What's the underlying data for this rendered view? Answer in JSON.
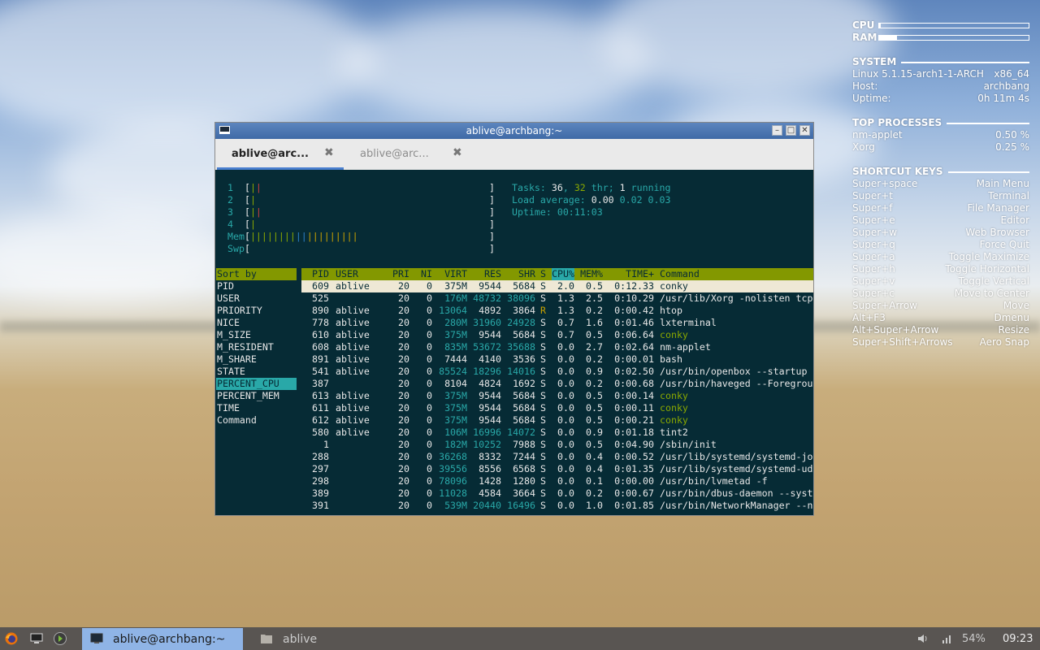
{
  "conky": {
    "cpu_label": "CPU",
    "ram_label": "RAM",
    "cpu_level": 0.01,
    "ram_level": 0.12,
    "system_title": "SYSTEM",
    "system": [
      {
        "k": "Linux 5.1.15-arch1-1-ARCH",
        "v": "x86_64"
      },
      {
        "k": "Host:",
        "v": "archbang"
      },
      {
        "k": "Uptime:",
        "v": "0h 11m 4s"
      }
    ],
    "top_title": "TOP PROCESSES",
    "top": [
      {
        "k": "nm-applet",
        "v": "0.50 %"
      },
      {
        "k": "Xorg",
        "v": "0.25 %"
      }
    ],
    "keys_title": "SHORTCUT KEYS",
    "keys": [
      {
        "k": "Super+space",
        "v": "Main Menu"
      },
      {
        "k": "Super+t",
        "v": "Terminal"
      },
      {
        "k": "Super+f",
        "v": "File Manager"
      },
      {
        "k": "Super+e",
        "v": "Editor"
      },
      {
        "k": "Super+w",
        "v": "Web Browser"
      },
      {
        "k": "Super+q",
        "v": "Force Quit"
      },
      {
        "k": "Super+a",
        "v": "Toggle Maximize"
      },
      {
        "k": "Super+h",
        "v": "Toggle Horizontal"
      },
      {
        "k": "Super+v",
        "v": "Toggle Vertical"
      },
      {
        "k": "Super+c",
        "v": "Move to Center"
      },
      {
        "k": "Super+Arrow",
        "v": "Move"
      },
      {
        "k": "Alt+F3",
        "v": "Dmenu"
      },
      {
        "k": "Alt+Super+Arrow",
        "v": "Resize"
      },
      {
        "k": "Super+Shift+Arrows",
        "v": "Aero Snap"
      }
    ]
  },
  "window": {
    "title": "ablive@archbang:~",
    "minimize": "–",
    "maximize": "□",
    "close": "✕",
    "tabs": [
      {
        "label": "ablive@arc...",
        "close": "✖"
      },
      {
        "label": "ablive@arc...",
        "close": "✖"
      }
    ]
  },
  "htop": {
    "meters": [
      {
        "label": "1",
        "bars": "||",
        "colors": [
          "green",
          "red"
        ]
      },
      {
        "label": "2",
        "bars": "|",
        "colors": [
          "green"
        ]
      },
      {
        "label": "3",
        "bars": "||",
        "colors": [
          "green",
          "red"
        ]
      },
      {
        "label": "4",
        "bars": "|",
        "colors": [
          "green"
        ]
      },
      {
        "label": "Mem",
        "bars": "|||||||||||||||||||",
        "colors": [
          "green",
          "green",
          "green",
          "green",
          "green",
          "green",
          "green",
          "green",
          "blue",
          "blue",
          "orange",
          "orange",
          "orange",
          "orange",
          "orange",
          "orange",
          "orange",
          "orange",
          "orange"
        ]
      },
      {
        "label": "Swp",
        "bars": "",
        "colors": []
      }
    ],
    "tasks_label": "Tasks: ",
    "tasks": "36",
    "thr": "32",
    "thr_label": " thr; ",
    "running": "1",
    "running_label": " running",
    "load_label": "Load average: ",
    "load1": "0.00",
    "load5": "0.02",
    "load15": "0.03",
    "uptime_label": "Uptime: ",
    "uptime": "00:11:03",
    "sort_title": "Sort by",
    "sort_items": [
      "PID",
      "USER",
      "PRIORITY",
      "NICE",
      "M_SIZE",
      "M_RESIDENT",
      "M_SHARE",
      "STATE",
      "PERCENT_CPU",
      "PERCENT_MEM",
      "TIME",
      "Command"
    ],
    "sort_selected": "PERCENT_CPU",
    "columns": [
      "PID",
      "USER",
      "PRI",
      "NI",
      "VIRT",
      "RES",
      "SHR",
      "S",
      "CPU%",
      "MEM%",
      "TIME+",
      "Command"
    ],
    "selected_column": "CPU%",
    "processes": [
      {
        "pid": "609",
        "user": "ablive",
        "pri": "20",
        "ni": "0",
        "virt": "375M",
        "res": "9544",
        "shr": "5684",
        "s": "S",
        "cpu": "2.0",
        "mem": "0.5",
        "time": "0:12.33",
        "cmd": "conky"
      },
      {
        "pid": "525",
        "user": "",
        "pri": "20",
        "ni": "0",
        "virt": "176M",
        "res": "48732",
        "shr": "38096",
        "s": "S",
        "cpu": "1.3",
        "mem": "2.5",
        "time": "0:10.29",
        "cmd": "/usr/lib/Xorg -nolisten tcp"
      },
      {
        "pid": "890",
        "user": "ablive",
        "pri": "20",
        "ni": "0",
        "virt": "13064",
        "res": "4892",
        "shr": "3864",
        "s": "R",
        "cpu": "1.3",
        "mem": "0.2",
        "time": "0:00.42",
        "cmd": "htop"
      },
      {
        "pid": "778",
        "user": "ablive",
        "pri": "20",
        "ni": "0",
        "virt": "280M",
        "res": "31960",
        "shr": "24928",
        "s": "S",
        "cpu": "0.7",
        "mem": "1.6",
        "time": "0:01.46",
        "cmd": "lxterminal"
      },
      {
        "pid": "610",
        "user": "ablive",
        "pri": "20",
        "ni": "0",
        "virt": "375M",
        "res": "9544",
        "shr": "5684",
        "s": "S",
        "cpu": "0.7",
        "mem": "0.5",
        "time": "0:06.64",
        "cmd": "conky"
      },
      {
        "pid": "608",
        "user": "ablive",
        "pri": "20",
        "ni": "0",
        "virt": "835M",
        "res": "53672",
        "shr": "35688",
        "s": "S",
        "cpu": "0.0",
        "mem": "2.7",
        "time": "0:02.64",
        "cmd": "nm-applet"
      },
      {
        "pid": "891",
        "user": "ablive",
        "pri": "20",
        "ni": "0",
        "virt": "7444",
        "res": "4140",
        "shr": "3536",
        "s": "S",
        "cpu": "0.0",
        "mem": "0.2",
        "time": "0:00.01",
        "cmd": "bash"
      },
      {
        "pid": "541",
        "user": "ablive",
        "pri": "20",
        "ni": "0",
        "virt": "85524",
        "res": "18296",
        "shr": "14016",
        "s": "S",
        "cpu": "0.0",
        "mem": "0.9",
        "time": "0:02.50",
        "cmd": "/usr/bin/openbox --startup"
      },
      {
        "pid": "387",
        "user": "",
        "pri": "20",
        "ni": "0",
        "virt": "8104",
        "res": "4824",
        "shr": "1692",
        "s": "S",
        "cpu": "0.0",
        "mem": "0.2",
        "time": "0:00.68",
        "cmd": "/usr/bin/haveged --Foregrou"
      },
      {
        "pid": "613",
        "user": "ablive",
        "pri": "20",
        "ni": "0",
        "virt": "375M",
        "res": "9544",
        "shr": "5684",
        "s": "S",
        "cpu": "0.0",
        "mem": "0.5",
        "time": "0:00.14",
        "cmd": "conky"
      },
      {
        "pid": "611",
        "user": "ablive",
        "pri": "20",
        "ni": "0",
        "virt": "375M",
        "res": "9544",
        "shr": "5684",
        "s": "S",
        "cpu": "0.0",
        "mem": "0.5",
        "time": "0:00.11",
        "cmd": "conky"
      },
      {
        "pid": "612",
        "user": "ablive",
        "pri": "20",
        "ni": "0",
        "virt": "375M",
        "res": "9544",
        "shr": "5684",
        "s": "S",
        "cpu": "0.0",
        "mem": "0.5",
        "time": "0:00.21",
        "cmd": "conky"
      },
      {
        "pid": "580",
        "user": "ablive",
        "pri": "20",
        "ni": "0",
        "virt": "106M",
        "res": "16996",
        "shr": "14072",
        "s": "S",
        "cpu": "0.0",
        "mem": "0.9",
        "time": "0:01.18",
        "cmd": "tint2"
      },
      {
        "pid": "1",
        "user": "",
        "pri": "20",
        "ni": "0",
        "virt": "182M",
        "res": "10252",
        "shr": "7988",
        "s": "S",
        "cpu": "0.0",
        "mem": "0.5",
        "time": "0:04.90",
        "cmd": "/sbin/init"
      },
      {
        "pid": "288",
        "user": "",
        "pri": "20",
        "ni": "0",
        "virt": "36268",
        "res": "8332",
        "shr": "7244",
        "s": "S",
        "cpu": "0.0",
        "mem": "0.4",
        "time": "0:00.52",
        "cmd": "/usr/lib/systemd/systemd-jo"
      },
      {
        "pid": "297",
        "user": "",
        "pri": "20",
        "ni": "0",
        "virt": "39556",
        "res": "8556",
        "shr": "6568",
        "s": "S",
        "cpu": "0.0",
        "mem": "0.4",
        "time": "0:01.35",
        "cmd": "/usr/lib/systemd/systemd-ud"
      },
      {
        "pid": "298",
        "user": "",
        "pri": "20",
        "ni": "0",
        "virt": "78096",
        "res": "1428",
        "shr": "1280",
        "s": "S",
        "cpu": "0.0",
        "mem": "0.1",
        "time": "0:00.00",
        "cmd": "/usr/bin/lvmetad -f"
      },
      {
        "pid": "389",
        "user": "",
        "pri": "20",
        "ni": "0",
        "virt": "11028",
        "res": "4584",
        "shr": "3664",
        "s": "S",
        "cpu": "0.0",
        "mem": "0.2",
        "time": "0:00.67",
        "cmd": "/usr/bin/dbus-daemon --syst"
      },
      {
        "pid": "391",
        "user": "",
        "pri": "20",
        "ni": "0",
        "virt": "539M",
        "res": "20440",
        "shr": "16496",
        "s": "S",
        "cpu": "0.0",
        "mem": "1.0",
        "time": "0:01.85",
        "cmd": "/usr/bin/NetworkManager --n"
      }
    ],
    "highlight_commands": [
      "conky"
    ],
    "colors": {
      "bg": "#062b35",
      "header": "#839800",
      "selected": "#29a8a8",
      "cyan": "#29a8a8",
      "green": "#8aa800",
      "red": "#cc3f3f",
      "blue": "#2f80c8",
      "orange": "#c8a100"
    }
  },
  "taskbar": {
    "launchers": [
      "firefox-icon",
      "desktop-icon",
      "terminal-launcher-icon"
    ],
    "tasks": [
      {
        "label": "ablive@archbang:~",
        "icon": "terminal-icon",
        "active": true
      },
      {
        "label": "ablive",
        "icon": "folder-icon",
        "active": false
      }
    ],
    "battery": "54%",
    "clock": "09:23"
  }
}
